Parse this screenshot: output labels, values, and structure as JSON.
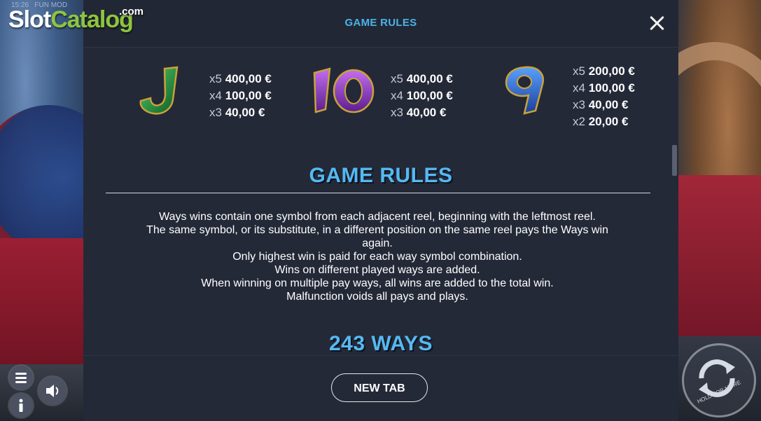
{
  "logo": {
    "slot": "Slot",
    "catalog": "Catalog",
    "com": ".com"
  },
  "status": {
    "time": "15:26",
    "mode": "FUN MOD"
  },
  "header": {
    "title": "GAME RULES"
  },
  "paytable": [
    {
      "symbol": "J",
      "color": "#1f8a3a",
      "icon": "letter-j-icon",
      "pays": [
        {
          "mult": "x5",
          "amount": "400,00 €"
        },
        {
          "mult": "x4",
          "amount": "100,00 €"
        },
        {
          "mult": "x3",
          "amount": "40,00 €"
        }
      ]
    },
    {
      "symbol": "10",
      "color": "#8a3bc0",
      "icon": "number-ten-icon",
      "pays": [
        {
          "mult": "x5",
          "amount": "400,00 €"
        },
        {
          "mult": "x4",
          "amount": "100,00 €"
        },
        {
          "mult": "x3",
          "amount": "40,00 €"
        }
      ]
    },
    {
      "symbol": "9",
      "color": "#2a63c9",
      "icon": "number-nine-icon",
      "pays": [
        {
          "mult": "x5",
          "amount": "200,00 €"
        },
        {
          "mult": "x4",
          "amount": "100,00 €"
        },
        {
          "mult": "x3",
          "amount": "40,00 €"
        },
        {
          "mult": "x2",
          "amount": "20,00 €"
        }
      ]
    }
  ],
  "game_rules": {
    "heading": "GAME RULES",
    "lines": [
      "Ways wins contain one symbol from each adjacent reel, beginning with the leftmost reel.",
      "The same symbol, or its substitute, in a different position on the same reel pays the Ways win again.",
      "Only highest win is paid for each way symbol combination.",
      "Wins on different played ways are added.",
      "When winning on multiple pay ways, all wins are added to the total win.",
      "Malfunction voids all pays and plays."
    ]
  },
  "ways": {
    "heading": "243 WAYS"
  },
  "footer": {
    "new_tab_label": "NEW TAB"
  },
  "spin": {
    "hold_label": "HOLD FOR MORE"
  },
  "colors": {
    "accent": "#56b9f0",
    "panel": "#242938",
    "brand_green": "#8dc53e"
  }
}
